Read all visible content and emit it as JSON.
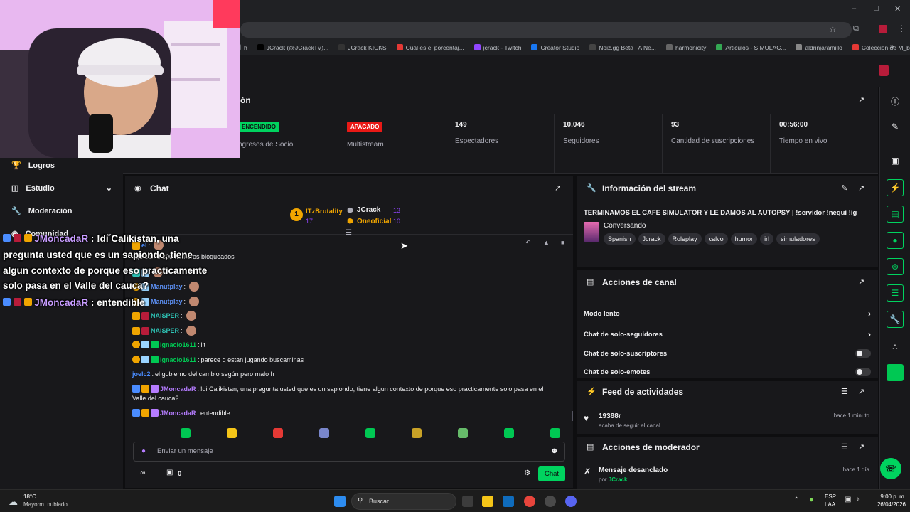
{
  "browser": {
    "bookmarks": [
      {
        "label": "h",
        "color": "#5f6368"
      },
      {
        "label": "JCrack (@JCrackTV)...",
        "color": "#000000"
      },
      {
        "label": "JCrack KICKS",
        "color": "#333333"
      },
      {
        "label": "Cuál es el porcentaj...",
        "color": "#e53935"
      },
      {
        "label": "jcrack - Twitch",
        "color": "#9146ff"
      },
      {
        "label": "Creator Studio",
        "color": "#1877f2"
      },
      {
        "label": "Noiz.gg Beta | A Ne...",
        "color": "#444444"
      },
      {
        "label": "harmonicity",
        "color": "#666666"
      },
      {
        "label": "Articulos - SIMULAC...",
        "color": "#34a853"
      },
      {
        "label": "aldrinjaramillo",
        "color": "#888888"
      },
      {
        "label": "Colección de M_blei...",
        "color": "#e53935"
      }
    ]
  },
  "sidebar": {
    "items": [
      {
        "label": "Logros",
        "icon": "trophy-icon"
      },
      {
        "label": "Estudio",
        "icon": "studio-icon",
        "expandable": true
      },
      {
        "label": "Moderación",
        "icon": "wrench-icon"
      },
      {
        "label": "Comunidad",
        "icon": "community-icon",
        "expandable": true
      }
    ]
  },
  "stats": {
    "title": "ón",
    "cells": [
      {
        "status": "ENCENDIDO",
        "status_color": "#00d35f",
        "label": "ngresos de Socio"
      },
      {
        "status": "APAGADO",
        "status_color": "#e91916",
        "label": "Multistream"
      },
      {
        "value": "149",
        "label": "Espectadores"
      },
      {
        "value": "10.046",
        "label": "Seguidores"
      },
      {
        "value": "93",
        "label": "Cantidad de suscripciones"
      },
      {
        "value": "00:56:00",
        "label": "Tiempo en vivo"
      }
    ]
  },
  "chat": {
    "title": "Chat",
    "leaderboard": {
      "rank": "1",
      "first": {
        "name": "ITzBrutality",
        "count": "17"
      },
      "second": {
        "name": "JCrack",
        "count": "13"
      },
      "third": {
        "name": "Oneoficial",
        "count": "10"
      }
    },
    "messages": [
      {
        "user": "el",
        "text": "",
        "color": "u-blue"
      },
      {
        "user": "",
        "text": "ngo como 300 números bloqueados",
        "color": "u-blue"
      },
      {
        "user": "",
        "text": "",
        "color": "u-blue"
      },
      {
        "user": "Manutplay",
        "text": "",
        "color": "u-blue2"
      },
      {
        "user": "Manutplay",
        "text": "",
        "color": "u-blue2"
      },
      {
        "user": "NAISPER",
        "text": "",
        "color": "u-teal"
      },
      {
        "user": "NAISPER",
        "text": "",
        "color": "u-teal"
      },
      {
        "user": "ignacio1611",
        "text": "lit",
        "color": "u-green"
      },
      {
        "user": "ignacio1611",
        "text": "parece q estan jugando buscaminas",
        "color": "u-green"
      },
      {
        "user": "joelc2",
        "text": "el gobierno del cambio según pero malo h",
        "color": "u-blue"
      },
      {
        "user": "JMoncadaR",
        "text": "!di Calikistan, una pregunta usted que es un sapiondo, tiene algun contexto de porque eso practicamente solo pasa en el",
        "text2": "Valle del cauca?",
        "color": "u-purple"
      },
      {
        "user": "JMoncadaR",
        "text": "entendible",
        "color": "u-purple"
      }
    ],
    "input_placeholder": "Enviar un mensaje",
    "points": "0",
    "send_label": "Chat"
  },
  "stream_info": {
    "title": "Información del stream",
    "stream_title": "TERMINAMOS EL CAFE SIMULATOR Y LE DAMOS AL AUTOPSY | !servidor !nequi !ig",
    "category": "Conversando",
    "tags": [
      "Spanish",
      "Jcrack",
      "Roleplay",
      "calvo",
      "humor",
      "irl",
      "simuladores"
    ]
  },
  "channel_actions": {
    "title": "Acciones de canal",
    "rows": [
      {
        "label": "Modo lento",
        "control": "chevron"
      },
      {
        "label": "Chat de solo-seguidores",
        "control": "chevron"
      },
      {
        "label": "Chat de solo-suscriptores",
        "control": "toggle"
      },
      {
        "label": "Chat de solo-emotes",
        "control": "toggle"
      }
    ]
  },
  "activity_feed": {
    "title": "Feed de actividades",
    "item": {
      "user": "19388r",
      "action": "acaba de seguir el canal",
      "time": "hace 1 minuto"
    }
  },
  "mod_actions": {
    "title": "Acciones de moderador",
    "item": {
      "action": "Mensaje desanclado",
      "by_prefix": "por",
      "by": "JCrack",
      "time": "hace 1 día"
    }
  },
  "overlay": {
    "lines": [
      {
        "name": "JMoncadaR",
        "sep": " : ",
        "text": "!di Calikistan, una"
      },
      {
        "name": "",
        "sep": "",
        "text": "pregunta usted que es un sapiondo, tiene"
      },
      {
        "name": "",
        "sep": "",
        "text": "algun contexto de porque eso practicamente"
      },
      {
        "name": "",
        "sep": "",
        "text": "solo pasa en el Valle del cauca?"
      },
      {
        "name": "JMoncadaR",
        "sep": " : ",
        "text": "entendible"
      }
    ]
  },
  "taskbar": {
    "weather_temp": "18°C",
    "weather_desc": "Mayorm. nublado",
    "search_placeholder": "Buscar",
    "lang": "ESP",
    "lang2": "LAA",
    "time": "9:00 p. m.",
    "date": "26/04/2026"
  }
}
